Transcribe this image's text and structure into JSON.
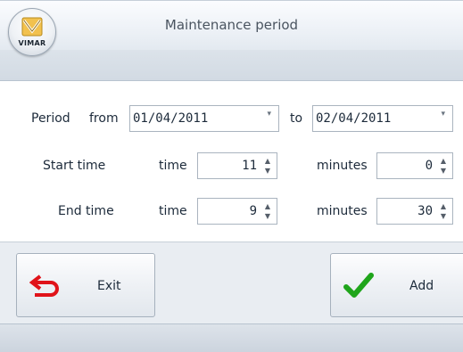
{
  "window": {
    "title": "Maintenance period"
  },
  "app_button": {
    "logo_text": "VIMAR",
    "icon": "vimar-logo-icon"
  },
  "period": {
    "label": "Period",
    "from_label": "from",
    "from_value": "01/04/2011",
    "to_label": "to",
    "to_value": "02/04/2011"
  },
  "start_time": {
    "label": "Start time",
    "time_label": "time",
    "time_value": "11",
    "minutes_label": "minutes",
    "minutes_value": "0"
  },
  "end_time": {
    "label": "End time",
    "time_label": "time",
    "time_value": "9",
    "minutes_label": "minutes",
    "minutes_value": "30"
  },
  "buttons": {
    "exit": {
      "label": "Exit",
      "icon": "exit-arrow-icon",
      "color": "#e0131a"
    },
    "add": {
      "label": "Add",
      "icon": "checkmark-icon",
      "color": "#1fa51b"
    }
  },
  "icons": {
    "dropdown": "▾",
    "spin_up": "▲",
    "spin_down": "▼"
  }
}
